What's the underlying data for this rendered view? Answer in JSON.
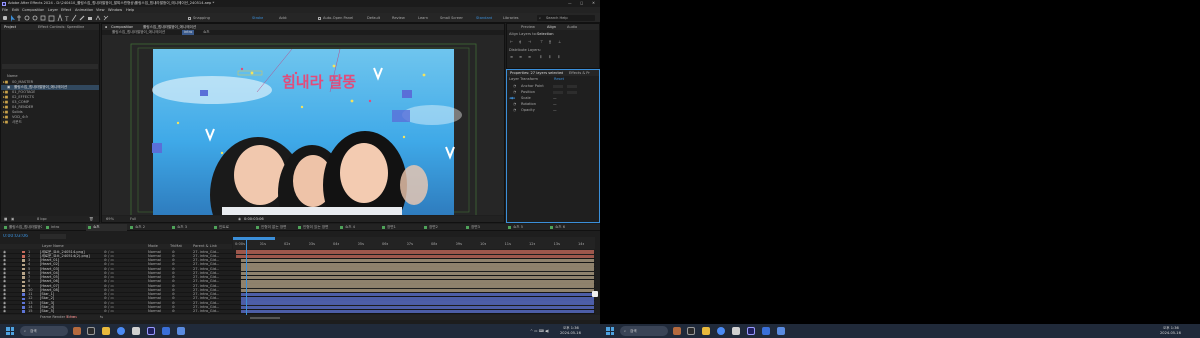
{
  "app": {
    "title": "Adobe After Effects 2024 - D:\\240410_롤링스집_힘내라팔뚱이_팔찌스캔형상\\롤링스집_힘내라팔뚱이_애니메이션_240514.aep *",
    "menu": [
      "File",
      "Edit",
      "Composition",
      "Layer",
      "Effect",
      "Animation",
      "View",
      "Window",
      "Help"
    ],
    "toolbar": {
      "snapping": "Snapping",
      "stroke": "Stroke",
      "add": "Add:",
      "auto_open": "Auto-Open Panel",
      "workspaces": [
        "Default",
        "Review",
        "Learn",
        "Small Screen",
        "Standard",
        "Libraries"
      ],
      "search": "Search Help"
    }
  },
  "project": {
    "tab_project": "Project",
    "tab_effect": "Effect Controls: Speedline",
    "col_name": "Name",
    "items": [
      {
        "label": "00_MASTER"
      },
      {
        "label": "롤링스집_힘내라팔뚱이_애니메이션"
      },
      {
        "label": "01_FOOTAGE"
      },
      {
        "label": "02_EFFECTS"
      },
      {
        "label": "03_COMP"
      },
      {
        "label": "04_RENDER"
      },
      {
        "label": "Solids"
      },
      {
        "label": "VOD_소스"
      },
      {
        "label": "사운드"
      }
    ],
    "bpc": "8 bpc"
  },
  "viewer": {
    "tab": "Composition",
    "comp_name": "롤링스집_힘내라팔뚱이_애니메이션",
    "breadcrumb": [
      "롤링스집_힘내라팔뚱이_애니메이션",
      "intro",
      "쇼츠"
    ],
    "overlay_title": "힘내라 딸뚱",
    "zoom": "69%",
    "quality": "Full",
    "timecode": "0:00:03:06"
  },
  "right": {
    "tabs": [
      "Preview",
      "Align",
      "Audio"
    ],
    "align_layers_to": "Align Layers to:",
    "align_target": "Selection",
    "distribute": "Distribute Layers:",
    "props_title": "Properties: 27 layers selected",
    "props_tab2": "Effects & Pr",
    "layer_transform": "Layer Transform",
    "reset": "Reset",
    "props": [
      {
        "label": "Anchor Point",
        "value": ""
      },
      {
        "label": "Position",
        "value": ""
      },
      {
        "label": "Scale",
        "value": "—"
      },
      {
        "label": "Rotation",
        "value": "—"
      },
      {
        "label": "Opacity",
        "value": "—"
      }
    ]
  },
  "comp_tabs": [
    "롤링스집_힘내라팔뚱이_애니메이션",
    "intro",
    "쇼츠",
    "쇼츠 2",
    "쇼츠 3",
    "인트로",
    "인형이 없는 장면",
    "인형이 있는 장면",
    "쇼츠 4",
    "장면1",
    "장면2",
    "장면3",
    "쇼츠 5",
    "쇼츠 6"
  ],
  "timeline": {
    "timecode": "0:00:03:06",
    "frame_render": "Frame Render Time:",
    "frame_render_val": "0.4ms",
    "col_layer": "Layer Name",
    "col_mode": "Mode",
    "col_trkmat": "TrkMat",
    "col_parent": "Parent & Link",
    "ruler": [
      "0:00s",
      "01s",
      "02s",
      "03s",
      "04s",
      "05s",
      "06s",
      "07s",
      "08s",
      "09s",
      "10s",
      "11s",
      "12s",
      "13s",
      "14s"
    ],
    "layers": [
      {
        "num": "1",
        "name": "[새로운_요소_240514.png]",
        "mode": "Normal",
        "parent": "27. intro_Gid...",
        "color": "#c86b5c"
      },
      {
        "num": "2",
        "name": "[새로운_요소_240514(2).png]",
        "mode": "Normal",
        "parent": "27. intro_Gid...",
        "color": "#c86b5c"
      },
      {
        "num": "3",
        "name": "[Heart_01]",
        "mode": "Normal",
        "parent": "27. intro_Gid...",
        "color": "#b6a488"
      },
      {
        "num": "4",
        "name": "[Heart_02]",
        "mode": "Normal",
        "parent": "27. intro_Gid...",
        "color": "#b6a488"
      },
      {
        "num": "5",
        "name": "[Heart_03]",
        "mode": "Normal",
        "parent": "27. intro_Gid...",
        "color": "#b6a488"
      },
      {
        "num": "6",
        "name": "[Heart_04]",
        "mode": "Normal",
        "parent": "27. intro_Gid...",
        "color": "#b6a488"
      },
      {
        "num": "7",
        "name": "[Heart_05]",
        "mode": "Normal",
        "parent": "27. intro_Gid...",
        "color": "#b6a488"
      },
      {
        "num": "8",
        "name": "[Heart_06]",
        "mode": "Normal",
        "parent": "27. intro_Gid...",
        "color": "#b6a488"
      },
      {
        "num": "9",
        "name": "[Heart_07]",
        "mode": "Normal",
        "parent": "27. intro_Gid...",
        "color": "#b6a488"
      },
      {
        "num": "10",
        "name": "[Heart_08]",
        "mode": "Normal",
        "parent": "27. intro_Gid...",
        "color": "#b6a488"
      },
      {
        "num": "11",
        "name": "[Star_1]",
        "mode": "Normal",
        "parent": "27. intro_Gid...",
        "color": "#5e74d6"
      },
      {
        "num": "12",
        "name": "[Star_2]",
        "mode": "Normal",
        "parent": "27. intro_Gid...",
        "color": "#5e74d6"
      },
      {
        "num": "13",
        "name": "[Star_3]",
        "mode": "Normal",
        "parent": "27. intro_Gid...",
        "color": "#5e74d6"
      },
      {
        "num": "14",
        "name": "[Star_4]",
        "mode": "Normal",
        "parent": "27. intro_Gid...",
        "color": "#5e74d6"
      },
      {
        "num": "15",
        "name": "[Star_5]",
        "mode": "Normal",
        "parent": "27. intro_Gid...",
        "color": "#5e74d6"
      }
    ]
  },
  "taskbar": {
    "search": "검색",
    "time": "오후 1:36",
    "date": "2024-05-16"
  }
}
